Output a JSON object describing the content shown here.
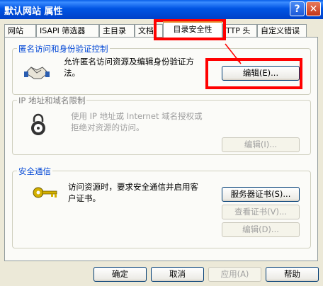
{
  "window": {
    "title": "默认网站 属性",
    "help_icon": "?",
    "close_icon": "✕"
  },
  "tabs": [
    {
      "label": "网站"
    },
    {
      "label": "ISAPI 筛选器"
    },
    {
      "label": "主目录"
    },
    {
      "label": "文档"
    },
    {
      "label": "目录安全性"
    },
    {
      "label": "TTP 头"
    },
    {
      "label": "自定义错误"
    }
  ],
  "anonymous": {
    "title": "匿名访问和身份验证控制",
    "desc_line1": "允许匿名访问资源及编辑身份验证方",
    "desc_line2": "法。",
    "edit_button": "编辑(E)...",
    "icon": "handshake-icon"
  },
  "ip": {
    "title": "IP 地址和域名限制",
    "desc_line1": "使用 IP 地址或 Internet 域名授权或",
    "desc_line2": "拒绝对资源的访问。",
    "edit_button": "编辑(I)...",
    "icon": "lock-icon"
  },
  "secure": {
    "title": "安全通信",
    "desc_line1": "访问资源时，要求安全通信并启用客",
    "desc_line2": "户证书。",
    "server_cert_button": "服务器证书(S)...",
    "view_cert_button": "查看证书(V)...",
    "edit_button": "编辑(D)...",
    "icon": "key-icon"
  },
  "footer": {
    "ok": "确定",
    "cancel": "取消",
    "apply": "应用(A)",
    "help": "帮助"
  },
  "colors": {
    "titlebar": "#0054e3",
    "highlight": "#ff0000",
    "tab_accent": "#e68b2c"
  }
}
